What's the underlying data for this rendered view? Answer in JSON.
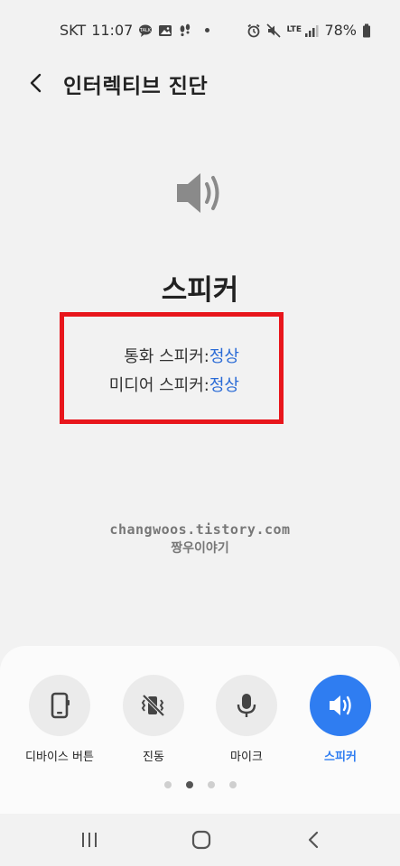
{
  "status_bar": {
    "carrier": "SKT",
    "time": "11:07",
    "battery": "78%",
    "lte_label": "LTE",
    "left_icons": [
      "talk-bubble-icon",
      "image-icon",
      "footsteps-icon"
    ],
    "right_icons": [
      "alarm-icon",
      "mute-icon",
      "lte-icon",
      "signal-icon",
      "battery-icon"
    ]
  },
  "app_bar": {
    "title": "인터렉티브 진단",
    "back_icon": "chevron-left-icon"
  },
  "main": {
    "hero_icon": "speaker-volume-icon",
    "section_title": "스피커",
    "results": [
      {
        "label": "통화 스피커:",
        "status": "정상"
      },
      {
        "label": "미디어 스피커:",
        "status": "정상"
      }
    ],
    "highlight_color": "#e8161c",
    "ok_color": "#2a6bd6"
  },
  "watermark": {
    "line1": "changwoos.tistory.com",
    "line2": "짱우이야기"
  },
  "tools": {
    "items": [
      {
        "label": "디바이스 버튼",
        "icon": "device-button-icon",
        "active": false
      },
      {
        "label": "진동",
        "icon": "vibration-off-icon",
        "active": false
      },
      {
        "label": "마이크",
        "icon": "microphone-icon",
        "active": false
      },
      {
        "label": "스피커",
        "icon": "speaker-icon",
        "active": true
      }
    ],
    "active_color": "#2f7df1",
    "page_count": 4,
    "current_page": 2
  },
  "nav_bar": {
    "buttons": [
      "recents-icon",
      "home-icon",
      "back-icon"
    ]
  }
}
